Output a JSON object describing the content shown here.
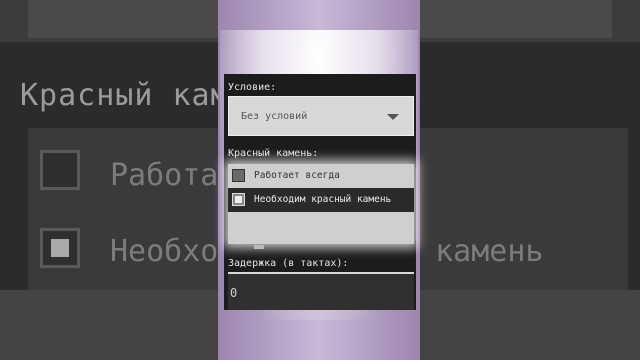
{
  "background": {
    "heading": "Красный камень:",
    "option1": "Работает всегда",
    "option2": "Необходим красный камень"
  },
  "dialog": {
    "condition_label": "Условие:",
    "condition_value": "Без условий",
    "redstone_label": "Красный камень:",
    "redstone_options": [
      {
        "label": "Работает всегда",
        "checked": false
      },
      {
        "label": "Необходим красный камень",
        "checked": true
      }
    ],
    "delay_label": "Задержка (в тактах):",
    "delay_value": "0"
  },
  "colors": {
    "strip": "#c9b8d6",
    "panel": "#1c1c1c",
    "dropdown": "#d8d8d8"
  }
}
